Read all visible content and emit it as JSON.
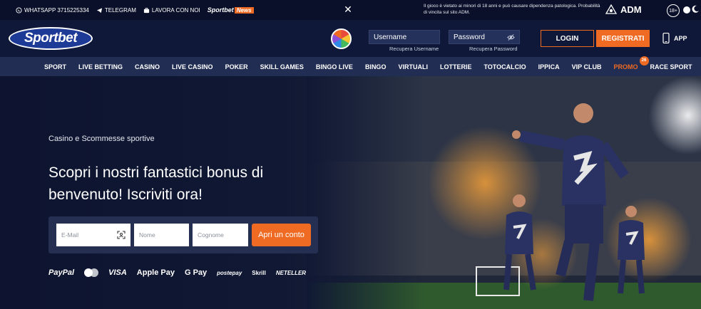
{
  "topbar": {
    "links": [
      {
        "icon": "whatsapp-icon",
        "label": "WHATSAPP 3715225334"
      },
      {
        "icon": "telegram-icon",
        "label": "TELEGRAM"
      },
      {
        "icon": "briefcase-icon",
        "label": "LAVORA CON NOI"
      }
    ],
    "news_brand": "Sportbet",
    "news_tag": "News",
    "warning": "Il gioco è vietato ai minori di 18 anni e può causare dipendenza patologica. Probabilità di vincita sul sito ADM.",
    "adm": "ADM",
    "age": "18+"
  },
  "header": {
    "logo": "Sportbet",
    "username_placeholder": "Username",
    "password_placeholder": "Password",
    "recover_username": "Recupera Username",
    "recover_password": "Recupera Password",
    "login": "LOGIN",
    "register": "REGISTRATI",
    "app": "APP"
  },
  "nav": {
    "items": [
      "SPORT",
      "LIVE BETTING",
      "CASINO",
      "LIVE CASINO",
      "POKER",
      "SKILL GAMES",
      "BINGO LIVE",
      "BINGO",
      "VIRTUALI",
      "LOTTERIE",
      "TOTOCALCIO",
      "IPPICA",
      "VIP CLUB",
      "PROMO",
      "RACE SPORT"
    ],
    "promo_badge": "26"
  },
  "hero": {
    "eyebrow": "Casino e Scommesse sportive",
    "title": "Scopri i nostri fantastici bonus di benvenuto! Iscriviti ora!",
    "email_placeholder": "E-Mail",
    "name_placeholder": "Nome",
    "surname_placeholder": "Cognome",
    "cta": "Apri un conto"
  },
  "payments": [
    "PayPal",
    "Mastercard",
    "VISA",
    "Apple Pay",
    "G Pay",
    "postepay",
    "Skrill",
    "NETELLER"
  ],
  "colors": {
    "accent": "#ef6a22",
    "bg": "#0d1533",
    "nav": "#212d52"
  }
}
